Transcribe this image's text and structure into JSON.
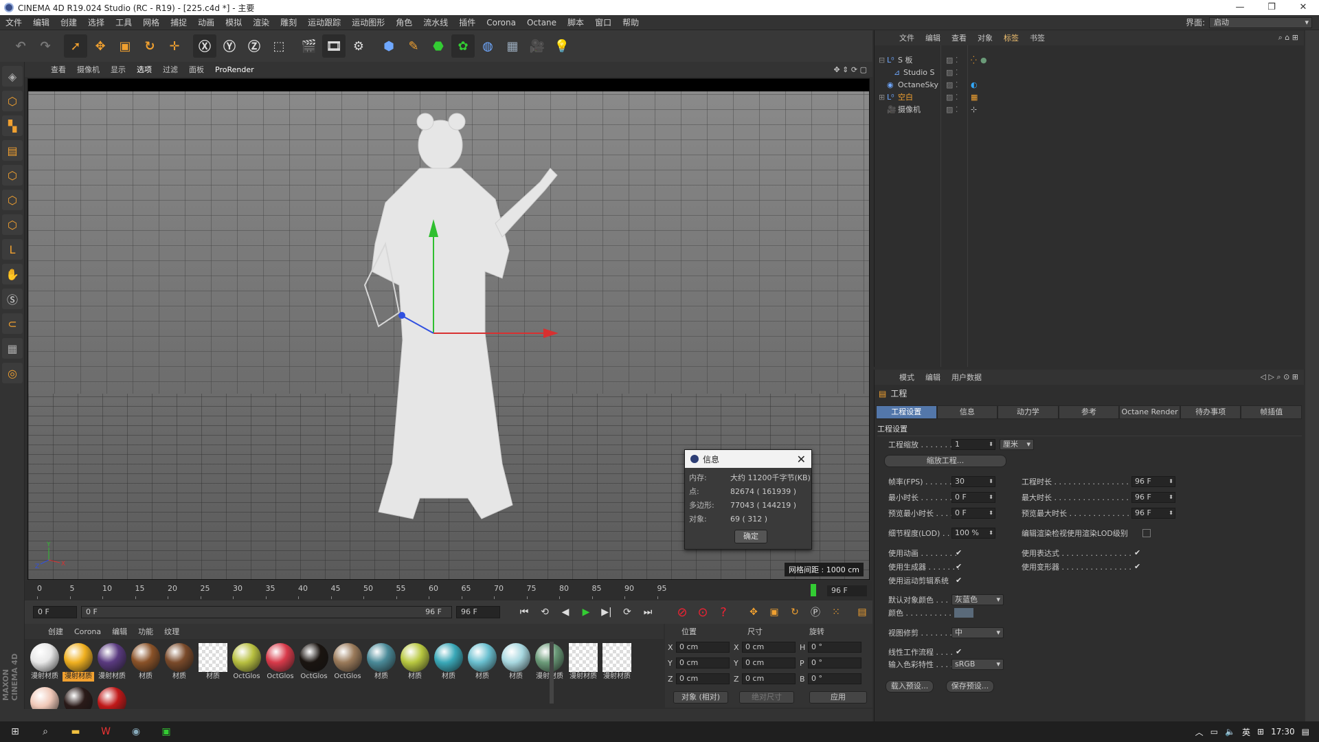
{
  "window": {
    "title": "CINEMA 4D R19.024 Studio (RC - R19) - [225.c4d *] - 主要"
  },
  "menu": [
    "文件",
    "编辑",
    "创建",
    "选择",
    "工具",
    "网格",
    "捕捉",
    "动画",
    "模拟",
    "渲染",
    "雕刻",
    "运动跟踪",
    "运动图形",
    "角色",
    "流水线",
    "插件",
    "Corona",
    "Octane",
    "脚本",
    "窗口",
    "帮助"
  ],
  "interface": {
    "label": "界面:",
    "value": "启动"
  },
  "viewport_menu": [
    "查看",
    "摄像机",
    "显示",
    "选项",
    "过滤",
    "面板",
    "ProRender"
  ],
  "viewport": {
    "grid_spacing": "网格间距 : 1000 cm"
  },
  "info_dialog": {
    "title": "信息",
    "rows": [
      {
        "k": "内存:",
        "v": "大约 11200千字节(KB)"
      },
      {
        "k": "点:",
        "v": "82674 ( 161939 )"
      },
      {
        "k": "多边形:",
        "v": "77043 ( 144219 )"
      },
      {
        "k": "对象:",
        "v": "69 ( 312 )"
      }
    ],
    "ok": "确定"
  },
  "timeline": {
    "ticks": [
      "0",
      "5",
      "10",
      "15",
      "20",
      "25",
      "30",
      "35",
      "40",
      "45",
      "50",
      "55",
      "60",
      "65",
      "70",
      "75",
      "80",
      "85",
      "90",
      "95"
    ],
    "current": "96 F",
    "start_field": "0 F",
    "range_start": "0 F",
    "range_end": "96 F",
    "end_field": "96 F",
    "current_frame": 96
  },
  "material_menu": [
    "创建",
    "Corona",
    "编辑",
    "功能",
    "纹理"
  ],
  "materials": [
    {
      "label": "漫射材质",
      "color": "#e8e8e8",
      "selected": false
    },
    {
      "label": "漫射材质",
      "color": "#f0b020",
      "selected": true
    },
    {
      "label": "漫射材质",
      "color": "#5a3a80",
      "selected": false
    },
    {
      "label": "材质",
      "color": "#8a5228",
      "selected": false
    },
    {
      "label": "材质",
      "color": "#7a4a2a",
      "selected": false
    },
    {
      "label": "材质",
      "color": "checker",
      "selected": false
    },
    {
      "label": "OctGlos",
      "color": "#b8c040",
      "selected": false
    },
    {
      "label": "OctGlos",
      "color": "#d83a4a",
      "selected": false
    },
    {
      "label": "OctGlos",
      "color": "#1a1410",
      "selected": false
    },
    {
      "label": "OctGlos",
      "color": "#9a7a5a",
      "selected": false
    },
    {
      "label": "材质",
      "color": "#4a8a98",
      "selected": false
    },
    {
      "label": "材质",
      "color": "#b8c840",
      "selected": false
    },
    {
      "label": "材质",
      "color": "#3aa8b8",
      "selected": false
    },
    {
      "label": "材质",
      "color": "#6ac0d0",
      "selected": false
    },
    {
      "label": "材质",
      "color": "#a8d8e0",
      "selected": false
    },
    {
      "label": "漫射材质",
      "color": "#6a9a78",
      "selected": false
    },
    {
      "label": "漫射材质",
      "color": "checker",
      "selected": false
    },
    {
      "label": "漫射材质",
      "color": "checker",
      "selected": false
    },
    {
      "label": "",
      "color": "#f0c8b8",
      "selected": false
    },
    {
      "label": "",
      "color": "#2a1a18",
      "selected": false
    },
    {
      "label": "",
      "color": "#c01818",
      "selected": false
    }
  ],
  "coords": {
    "headers": [
      "位置",
      "尺寸",
      "旋转"
    ],
    "rows": [
      {
        "a": "X",
        "av": "0 cm",
        "b": "X",
        "bv": "0 cm",
        "c": "H",
        "cv": "0 °"
      },
      {
        "a": "Y",
        "av": "0 cm",
        "b": "Y",
        "bv": "0 cm",
        "c": "P",
        "cv": "0 °"
      },
      {
        "a": "Z",
        "av": "0 cm",
        "b": "Z",
        "bv": "0 cm",
        "c": "B",
        "cv": "0 °"
      }
    ],
    "mode": "对象 (相对)",
    "size_mode": "绝对尺寸",
    "apply": "应用"
  },
  "object_manager": {
    "menu": [
      "文件",
      "编辑",
      "查看",
      "对象",
      "标签",
      "书签"
    ],
    "objects": [
      "S 板",
      "Studio S",
      "OctaneSky",
      "空白",
      "摄像机"
    ]
  },
  "attributes": {
    "menu": [
      "模式",
      "编辑",
      "用户数据"
    ],
    "title": "工程",
    "tabs": [
      "工程设置",
      "信息",
      "动力学",
      "参考",
      "Octane Render",
      "待办事项",
      "帧插值"
    ],
    "section": "工程设置",
    "scale_label": "工程缩放 . . . . . . .",
    "scale_value": "1",
    "scale_unit": "厘米",
    "scale_btn": "缩放工程...",
    "fps_label": "帧率(FPS) . . . . . . .",
    "fps": "30",
    "projlen_label": "工程时长 . . . . . . . . . . . . . . . . . .",
    "projlen": "96 F",
    "min_label": "最小时长 . . . . . . . .",
    "min": "0 F",
    "max_label": "最大时长 . . . . . . . . . . . . . . . . . .",
    "max": "96 F",
    "pmin_label": "预览最小时长 . . . .",
    "pmin": "0 F",
    "pmax_label": "预览最大时长 . . . . . . . . . . . . . .",
    "pmax": "96 F",
    "lod_label": "细节程度(LOD) . . .",
    "lod": "100 %",
    "lod_render_label": "编辑渲染检视使用渲染LOD级别",
    "anim_label": "使用动画 . . . . . . . .",
    "expr_label": "使用表达式 . . . . . . . . . . . . . . . .",
    "gen_label": "使用生成器 . . . . . . .",
    "deform_label": "使用变形器 . . . . . . . . . . . . . . . .",
    "mograph_label": "使用运动剪辑系统",
    "objcolor_label": "默认对象颜色 . . .",
    "objcolor": "灰蓝色",
    "color_label": "颜色 . . . . . . . . . . .",
    "clip_label": "视图修剪 . . . . . . . .",
    "clip": "中",
    "linear_label": "线性工作流程 . . . .",
    "colorprof_label": "输入色彩特性 . . . .",
    "colorprof": "sRGB",
    "load_preset": "载入预设...",
    "save_preset": "保存预设..."
  },
  "taskbar": {
    "ime": "英",
    "time": "17:30"
  },
  "colors": {
    "accent": "#f0a030",
    "tab_active": "#5377aa",
    "selected_material": "#f0a030"
  }
}
